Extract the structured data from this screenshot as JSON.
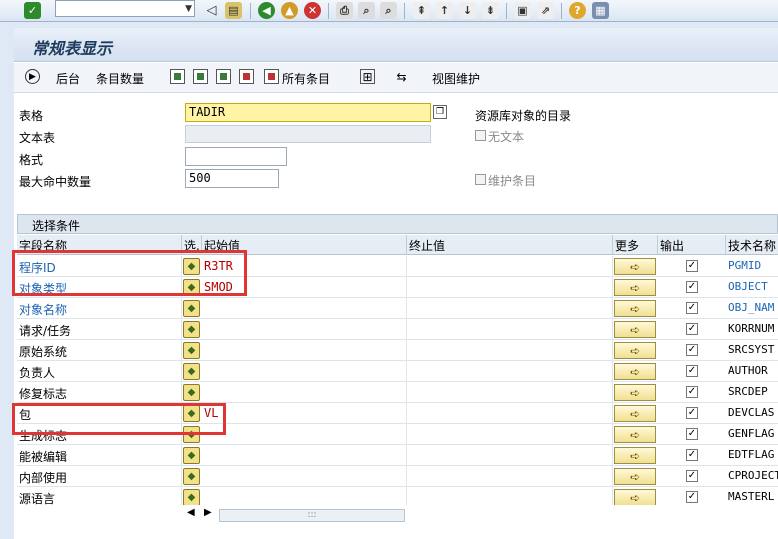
{
  "page_title": "常规表显示",
  "toolbar": {
    "background": "后台",
    "entry_count": "条目数量",
    "all_entries": "所有条目",
    "view_maintenance": "视图维护"
  },
  "form": {
    "table_label": "表格",
    "table_value": "TADIR",
    "table_desc": "资源库对象的目录",
    "text_table_label": "文本表",
    "no_text_label": "无文本",
    "format_label": "格式",
    "max_hits_label": "最大命中数量",
    "max_hits_value": "500",
    "maintain_entries_label": "维护条目"
  },
  "selection": {
    "title": "选择条件",
    "columns": {
      "field_name": "字段名称",
      "sel": "选.",
      "from": "起始值",
      "to": "终止值",
      "more": "更多",
      "output": "输出",
      "tech_name": "技术名称"
    },
    "rows": [
      {
        "field": "程序ID",
        "from": "R3TR",
        "tech": "PGMID",
        "link": true
      },
      {
        "field": "对象类型",
        "from": "SMOD",
        "tech": "OBJECT",
        "link": true
      },
      {
        "field": "对象名称",
        "from": "",
        "tech": "OBJ_NAM",
        "link": true
      },
      {
        "field": "请求/任务",
        "from": "",
        "tech": "KORRNUM",
        "link": false
      },
      {
        "field": "原始系统",
        "from": "",
        "tech": "SRCSYST",
        "link": false
      },
      {
        "field": "负责人",
        "from": "",
        "tech": "AUTHOR",
        "link": false
      },
      {
        "field": "修复标志",
        "from": "",
        "tech": "SRCDEP",
        "link": false
      },
      {
        "field": "包",
        "from": "VL",
        "tech": "DEVCLAS",
        "link": false
      },
      {
        "field": "生成标志",
        "from": "",
        "tech": "GENFLAG",
        "link": false
      },
      {
        "field": "能被编辑",
        "from": "",
        "tech": "EDTFLAG",
        "link": false
      },
      {
        "field": "内部使用",
        "from": "",
        "tech": "CPROJECT",
        "link": false
      },
      {
        "field": "源语言",
        "from": "",
        "tech": "MASTERL",
        "link": false
      }
    ]
  },
  "icons": {
    "enter": "checkmark-icon",
    "save": "save-icon",
    "back": "back-icon",
    "exit": "exit-icon",
    "cancel": "cancel-icon",
    "more": "arrow-right-icon",
    "output": "checkmark-icon"
  },
  "colors": {
    "link": "#1c64b4",
    "value": "#b30000",
    "highlight": "#e03535",
    "required_field": "#fff3a6"
  }
}
